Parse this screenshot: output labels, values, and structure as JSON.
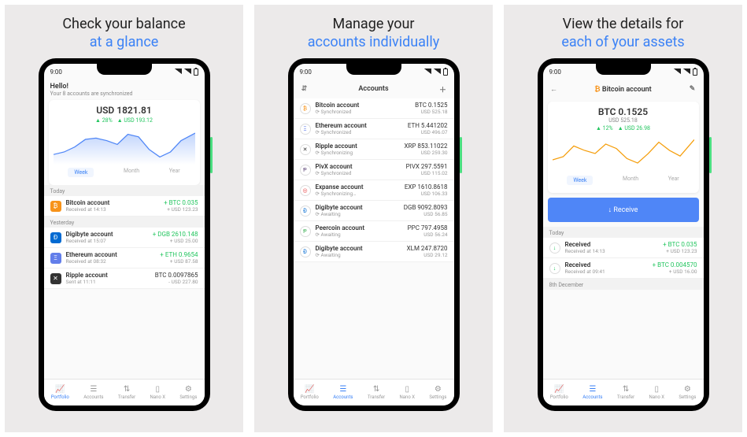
{
  "status_time": "9:00",
  "panels": {
    "p1": {
      "head_line1": "Check your balance",
      "head_line2": "at a glance",
      "hello": "Hello!",
      "sync": "Your 8 accounts are synchronized",
      "balance": "USD 1821.81",
      "pct": "▲ 28%",
      "delta": "▲ USD 193.12",
      "ranges": {
        "week": "Week",
        "month": "Month",
        "year": "Year"
      },
      "today_h": "Today",
      "yesterday_h": "Yesterday",
      "tx": {
        "t1": {
          "name": "Bitcoin account",
          "sub": "Received at 14:13",
          "amt": "+ BTC 0.035",
          "fiat": "+ USD 123.23"
        },
        "t2": {
          "name": "Digibyte account",
          "sub": "Received at 15:07",
          "amt": "+ DGB 2610.148",
          "fiat": "+ USD 25.00"
        },
        "t3": {
          "name": "Ethereum account",
          "sub": "Received at 08:32",
          "amt": "+ ETH 0.9654",
          "fiat": "+ USD 87.58"
        },
        "t4": {
          "name": "Ripple account",
          "sub": "Sent at 11:11",
          "amt": "BTC 0.0097865",
          "fiat": "- USD 227.80"
        }
      }
    },
    "p2": {
      "head_line1": "Manage your",
      "head_line2": "accounts individually",
      "title": "Accounts",
      "accts": {
        "a1": {
          "name": "Bitcoin account",
          "status": "Synchronized",
          "amt": "BTC 0.1525",
          "fiat": "USD 525.18",
          "glyph": "₿",
          "color": "#f7931a"
        },
        "a2": {
          "name": "Ethereum account",
          "status": "Synchronized",
          "amt": "ETH 5.441202",
          "fiat": "USD 496.07",
          "glyph": "Ξ",
          "color": "#627eea"
        },
        "a3": {
          "name": "Ripple  account",
          "status": "Synchronizing",
          "amt": "XRP 853.11022",
          "fiat": "USD 259.30",
          "glyph": "✕",
          "color": "#333"
        },
        "a4": {
          "name": "PivX account",
          "status": "Synchronized",
          "amt": "PIVX 297.5591",
          "fiat": "USD 115.02",
          "glyph": "Ᵽ",
          "color": "#5e4778"
        },
        "a5": {
          "name": "Expanse account",
          "status": "Synchronizing…",
          "amt": "EXP 1610.8618",
          "fiat": "USD 106.33",
          "glyph": "◎",
          "color": "#e84142"
        },
        "a6": {
          "name": "Digibyte account",
          "status": "Awaiting",
          "amt": "DGB 9092.8093",
          "fiat": "USD 56.85",
          "glyph": "Ð",
          "color": "#006ad2"
        },
        "a7": {
          "name": "Peercoin account",
          "status": "Awaiting",
          "amt": "PPC 797.4958",
          "fiat": "USD 56.24",
          "glyph": "Ᵽ",
          "color": "#3cb054"
        },
        "a8": {
          "name": "Digibyte account",
          "status": "Awaiting",
          "amt": "XLM 247.8720",
          "fiat": "USD 29.12",
          "glyph": "Ð",
          "color": "#006ad2"
        }
      }
    },
    "p3": {
      "head_line1": "View the details for",
      "head_line2": "each of your assets",
      "title": "Bitcoin account",
      "balance": "BTC 0.1525",
      "fiat": "USD 525.18",
      "pct": "▲ 12%",
      "delta": "▲ USD 26.98",
      "receive": "↓  Receive",
      "today_h": "Today",
      "dec_h": "8th December",
      "tx": {
        "t1": {
          "name": "Received",
          "sub": "Received at 14:13",
          "amt": "+ BTC 0.035",
          "fiat": "+ USD 123.23"
        },
        "t2": {
          "name": "Received",
          "sub": "Received at 09:41",
          "amt": "+ BTC 0.004570",
          "fiat": "+ USD 16.00"
        }
      }
    }
  },
  "nav": {
    "portfolio": "Portfolio",
    "accounts": "Accounts",
    "transfer": "Transfer",
    "nano": "Nano X",
    "settings": "Settings"
  },
  "chart_data": [
    {
      "type": "line",
      "panel": 1,
      "title": "USD 1821.81",
      "ylabel": "USD",
      "ylim": [
        1600,
        1900
      ],
      "x": [
        0,
        1,
        2,
        3,
        4,
        5,
        6,
        7,
        8,
        9,
        10,
        11,
        12,
        13
      ],
      "values": [
        1680,
        1700,
        1740,
        1800,
        1810,
        1790,
        1760,
        1840,
        1820,
        1720,
        1660,
        1700,
        1790,
        1850
      ],
      "pct_change": 28,
      "abs_change": 193.12,
      "color": "#4f86f7",
      "fill": true
    },
    {
      "type": "line",
      "panel": 3,
      "title": "BTC 0.1525",
      "ylabel": "USD",
      "ylim": [
        490,
        560
      ],
      "x": [
        0,
        1,
        2,
        3,
        4,
        5,
        6,
        7,
        8,
        9,
        10,
        11,
        12,
        13
      ],
      "values": [
        505,
        515,
        540,
        530,
        520,
        545,
        535,
        510,
        500,
        520,
        548,
        530,
        515,
        552
      ],
      "pct_change": 12,
      "abs_change": 26.98,
      "color": "#f59e0b",
      "fill": false
    }
  ]
}
